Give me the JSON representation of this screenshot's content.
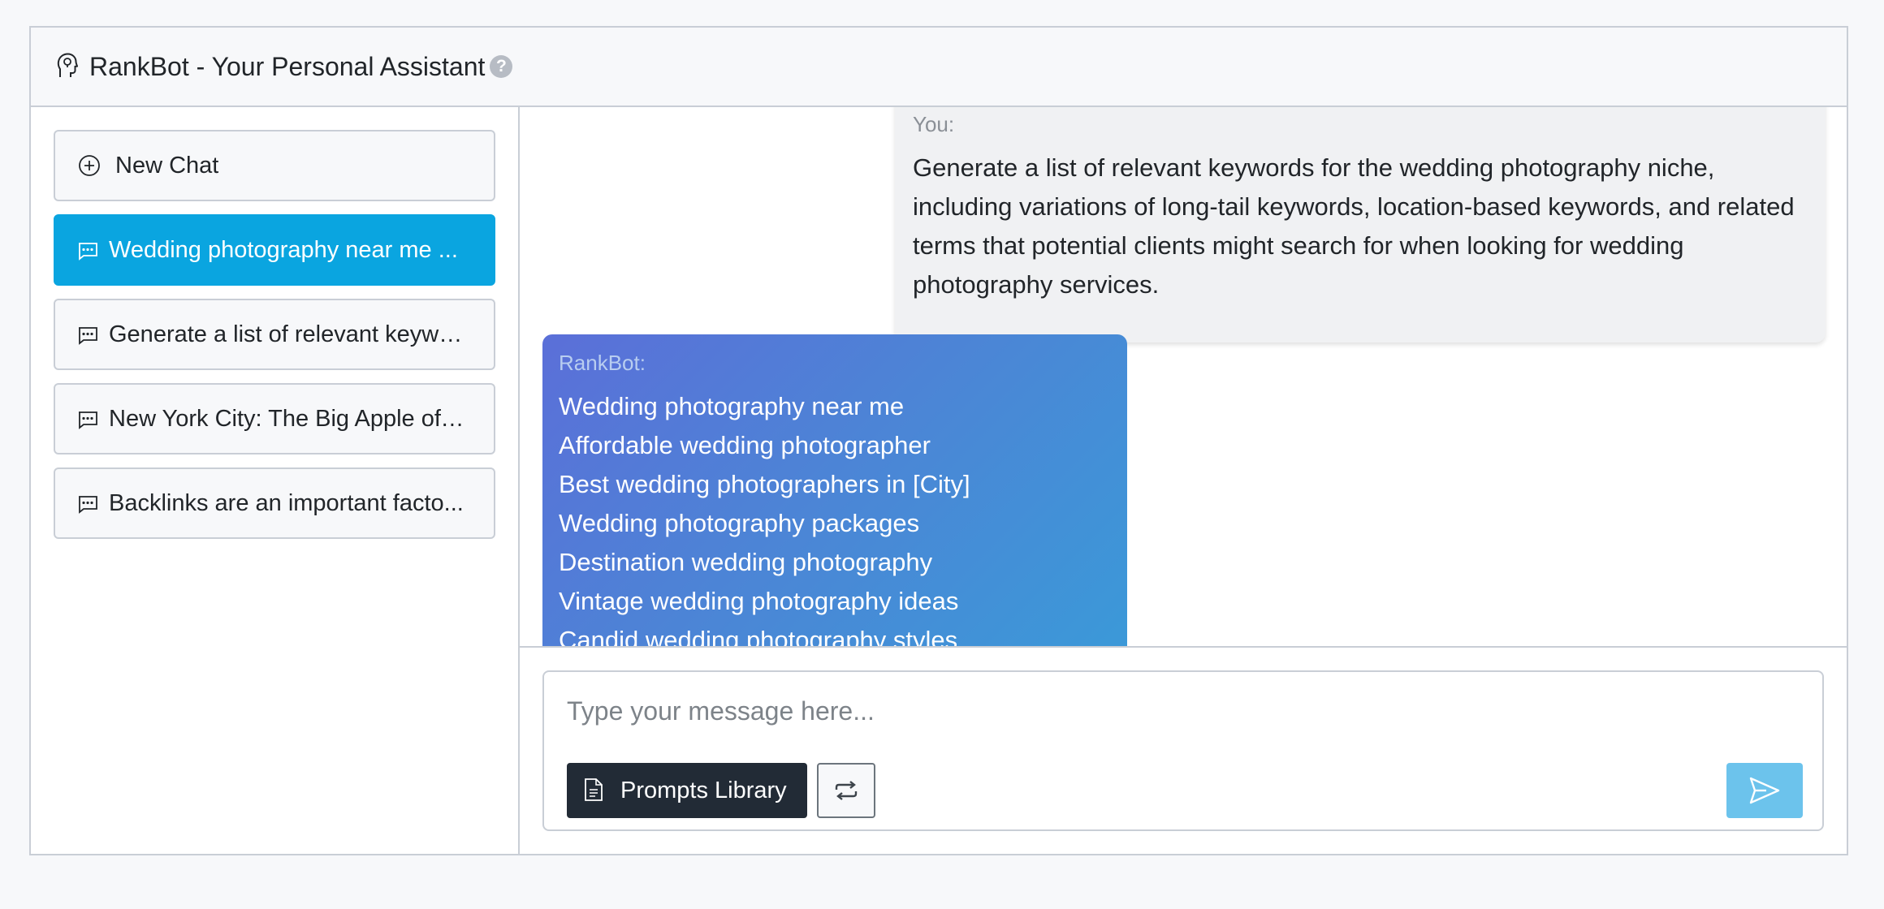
{
  "header": {
    "title": "RankBot - Your Personal Assistant",
    "help": "?"
  },
  "sidebar": {
    "new_chat": "New Chat",
    "items": [
      {
        "label": "Wedding photography near me ...",
        "active": true
      },
      {
        "label": "Generate a list of relevant keywo...",
        "active": false
      },
      {
        "label": "New York City: The Big Apple off...",
        "active": false
      },
      {
        "label": "Backlinks are an important facto...",
        "active": false
      }
    ]
  },
  "chat": {
    "user_message": {
      "author": "You:",
      "text": "Generate a list of relevant keywords for the wedding photography niche, including variations of long-tail keywords, location-based keywords, and related terms that potential clients might search for when looking for wedding photography services."
    },
    "bot_message": {
      "author": "RankBot:",
      "lines": [
        "Wedding photography near me",
        "Affordable wedding photographer",
        "Best wedding photographers in [City]",
        "Wedding photography packages",
        "Destination wedding photography",
        "Vintage wedding photography ideas",
        "Candid wedding photography styles"
      ]
    }
  },
  "composer": {
    "placeholder": "Type your message here...",
    "prompts_label": "Prompts Library"
  },
  "icons": {
    "header": "head-bulb-icon",
    "new_chat": "plus-circle-icon",
    "chat_item": "chat-dots-icon",
    "prompts": "file-text-icon",
    "repeat": "repeat-icon",
    "send": "send-icon"
  },
  "colors": {
    "active_item": "#0aa5e0",
    "prompts_button": "#222b36",
    "send_button": "#6cc3ec",
    "bot_gradient_start": "#5b6fd8",
    "bot_gradient_end": "#3a9ad8"
  }
}
